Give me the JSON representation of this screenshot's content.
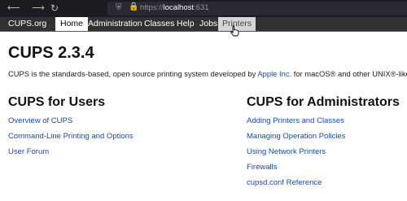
{
  "browser": {
    "url_scheme": "https://",
    "url_host": "localhost",
    "url_port": ":631",
    "icons": [
      "back-icon",
      "forward-icon",
      "reload-icon",
      "shield-icon",
      "lock-icon"
    ]
  },
  "nav": {
    "items": [
      {
        "label": "CUPS.org"
      },
      {
        "label": "Home",
        "state": "active"
      },
      {
        "label": "Administration"
      },
      {
        "label": "Classes"
      },
      {
        "label": "Help"
      },
      {
        "label": "Jobs"
      },
      {
        "label": "Printers",
        "state": "hover"
      }
    ]
  },
  "page": {
    "title": "CUPS 2.3.4",
    "intro_before": "CUPS is the standards-based, open source printing system developed by ",
    "intro_link": "Apple Inc.",
    "intro_after": " for macOS® and other UNIX®-like oper"
  },
  "users": {
    "title": "CUPS for Users",
    "links": [
      "Overview of CUPS",
      "Command-Line Printing and Options",
      "User Forum"
    ]
  },
  "admins": {
    "title": "CUPS for Administrators",
    "links": [
      "Adding Printers and Classes",
      "Managing Operation Policies",
      "Using Network Printers",
      "Firewalls",
      "cupsd.conf Reference"
    ]
  },
  "colors": {
    "nav_background": "#313131",
    "link": "#1a4b9a",
    "browser_chrome": "#1c1b22"
  }
}
